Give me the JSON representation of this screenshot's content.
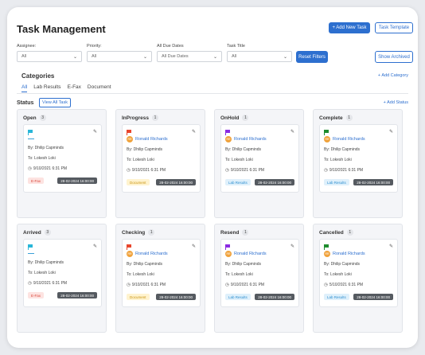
{
  "header": {
    "title": "Task Management",
    "add_task_label": "+ Add New Task",
    "template_label": "Task Template"
  },
  "filters": {
    "assignee": {
      "label": "Assignee:",
      "value": "All"
    },
    "priority": {
      "label": "Priority:",
      "value": "All"
    },
    "due_dates": {
      "label": "All Due Dates",
      "value": "All Due Dates"
    },
    "task_title": {
      "label": "Task Title",
      "value": "All"
    },
    "reset_label": "Reset Filters",
    "archived_label": "Show Archived"
  },
  "categories": {
    "title": "Categories",
    "add_label": "+ Add Category",
    "tabs": [
      "All",
      "Lab Results",
      "E-Fax",
      "Document"
    ]
  },
  "status": {
    "label": "Status",
    "view_all_label": "View All Task",
    "add_label": "+ Add Status"
  },
  "colors": {
    "accent": "#2d6fcf",
    "flag_cyan": "#29b6d8",
    "flag_red": "#e8452c",
    "flag_purple": "#8a2be2",
    "flag_green": "#1e8c2e",
    "efax_bg": "#fde3e1",
    "efax_fg": "#d9463a",
    "doc_bg": "#fff3cf",
    "doc_fg": "#c99410",
    "lab_bg": "#dff0fb",
    "lab_fg": "#2d8fd0"
  },
  "columns": [
    {
      "name": "Open",
      "count": "3",
      "flag": "cyan",
      "assignee": "",
      "initials": "",
      "by": "By:  Dhilip Capminds",
      "to": "To:  Lokesh Loki",
      "time": "9/10/2021 6:31 PM",
      "tag": "E-Fax",
      "tag_type": "efax",
      "date": "28-02-2024 16:00:00"
    },
    {
      "name": "InProgress",
      "count": "1",
      "flag": "red",
      "assignee": "Ronald Richards",
      "initials": "RR",
      "by": "By:  Dhilip Capminds",
      "to": "To:  Lokesh Loki",
      "time": "9/10/2021 6:31 PM",
      "tag": "Document",
      "tag_type": "doc",
      "date": "28-02-2024 16:00:00"
    },
    {
      "name": "OnHold",
      "count": "1",
      "flag": "purple",
      "assignee": "Ronald Richards",
      "initials": "RR",
      "by": "By:  Dhilip Capminds",
      "to": "To:  Lokesh Loki",
      "time": "9/10/2021 6:31 PM",
      "tag": "Lab Results",
      "tag_type": "lab",
      "date": "28-02-2024 16:00:00"
    },
    {
      "name": "Complete",
      "count": "1",
      "flag": "green",
      "assignee": "Ronald Richards",
      "initials": "RR",
      "by": "By:  Dhilip Capminds",
      "to": "To:  Lokesh Loki",
      "time": "9/10/2021 6:31 PM",
      "tag": "Lab Results",
      "tag_type": "lab",
      "date": "28-02-2024 16:00:00"
    },
    {
      "name": "Arrived",
      "count": "3",
      "flag": "cyan",
      "assignee": "",
      "initials": "",
      "by": "By:  Dhilip Capminds",
      "to": "To:  Lokesh Loki",
      "time": "9/10/2021 6:31 PM",
      "tag": "E-Fax",
      "tag_type": "efax",
      "date": "28-02-2024 16:00:00"
    },
    {
      "name": "Checking",
      "count": "1",
      "flag": "red",
      "assignee": "Ronald Richards",
      "initials": "RR",
      "by": "By:  Dhilip Capminds",
      "to": "To:  Lokesh Loki",
      "time": "9/10/2021 6:31 PM",
      "tag": "Document",
      "tag_type": "doc",
      "date": "28-02-2024 16:00:00"
    },
    {
      "name": "Resend",
      "count": "1",
      "flag": "purple",
      "assignee": "Ronald Richards",
      "initials": "RR",
      "by": "By:  Dhilip Capminds",
      "to": "To:  Lokesh Loki",
      "time": "9/10/2021 6:31 PM",
      "tag": "Lab Results",
      "tag_type": "lab",
      "date": "28-02-2024 16:00:00"
    },
    {
      "name": "Cancelled",
      "count": "1",
      "flag": "green",
      "assignee": "Ronald Richards",
      "initials": "RR",
      "by": "By:  Dhilip Capminds",
      "to": "To:  Lokesh Loki",
      "time": "5/10/2021 6:31 PM",
      "tag": "Lab Results",
      "tag_type": "lab",
      "date": "28-02-2024 16:00:00"
    }
  ]
}
